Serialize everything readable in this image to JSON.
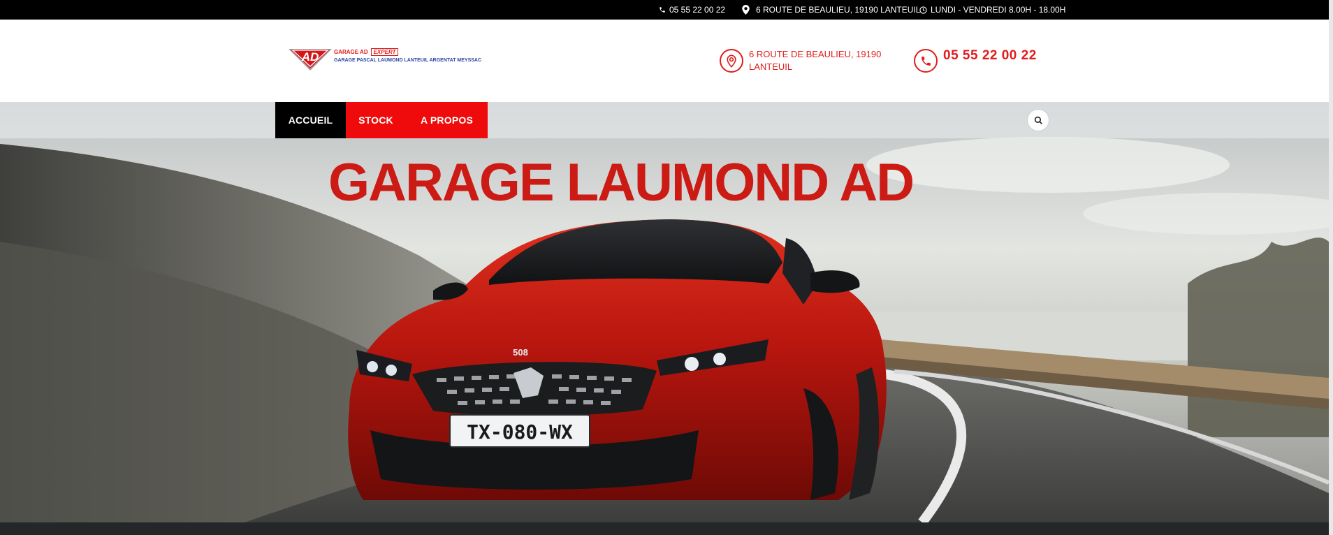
{
  "topbar": {
    "phone": "05 55 22 00 22",
    "address": "6 ROUTE DE BEAULIEU, 19190 LANTEUIL",
    "hours": "LUNDI - VENDREDI 8.00H - 18.00H"
  },
  "logo": {
    "badge": "AD",
    "line1": "GARAGE AD",
    "expert": "EXPERT",
    "line2": "GARAGE PASCAL LAUMOND LANTEUIL ARGENTAT MEYSSAC"
  },
  "header": {
    "address": "6 ROUTE DE BEAULIEU, 19190 LANTEUIL",
    "phone": "05 55 22 00 22"
  },
  "nav": {
    "items": [
      {
        "label": "ACCUEIL"
      },
      {
        "label": "STOCK"
      },
      {
        "label": "A PROPOS"
      }
    ]
  },
  "hero": {
    "title": "GARAGE LAUMOND AD",
    "car_badge": "508",
    "plate": "TX-080-WX"
  },
  "colors": {
    "accent": "#ef0b0b",
    "title": "#cc1a14",
    "topbar": "#000000",
    "blue": "#2a47a3"
  },
  "icons": {
    "topbar_phone": "phone-icon",
    "topbar_address": "map-marker-icon",
    "topbar_hours": "clock-icon",
    "header_address": "location-pin-icon",
    "header_phone": "phone-icon",
    "search": "search-icon"
  }
}
